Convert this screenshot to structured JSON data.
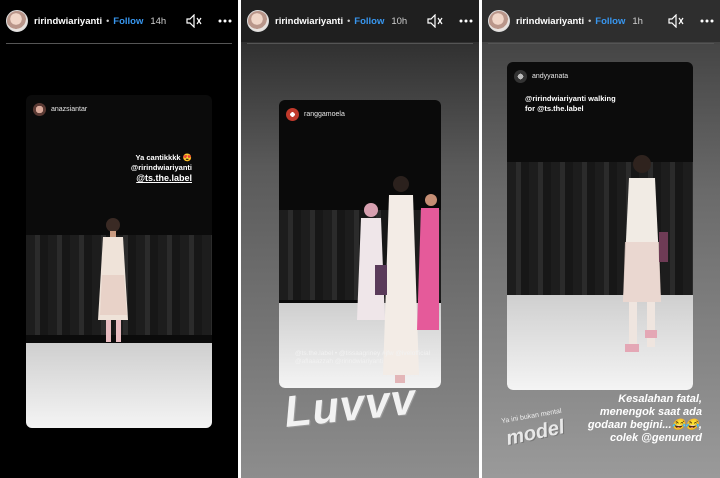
{
  "stories": [
    {
      "username": "ririndwiariyanti",
      "separator": "•",
      "follow_label": "Follow",
      "age": "14h",
      "card": {
        "poster": "anazsiantar",
        "caption_line1": "Ya cantikkkk 😍",
        "caption_line2": "@ririndwiariyanti",
        "caption_line3": "@ts.the.label"
      }
    },
    {
      "username": "ririndwiariyanti",
      "separator": "•",
      "follow_label": "Follow",
      "age": "10h",
      "card": {
        "poster": "ranggamoela",
        "caption_line1": "@ts.the.label • @tissaagriney #jfw @ivelofficial",
        "caption_line2": "@aflaaazzah @ririndwiariyanti"
      },
      "sticker_text": "Luvvv"
    },
    {
      "username": "ririndwiariyanti",
      "separator": "•",
      "follow_label": "Follow",
      "age": "1h",
      "card": {
        "poster": "andyyanata",
        "caption_line1": "@ririndwiariyanti walking",
        "caption_line2": "for @ts.the.label"
      },
      "small_text": "Ya ini bukan mental",
      "model_text": "model",
      "comment_line1": "Kesalahan fatal,",
      "comment_line2": "menengok saat ada",
      "comment_line3": "godaan begini...😂😂,",
      "comment_line4": "colek @genunerd"
    }
  ],
  "icons": {
    "volume": "speaker-icon",
    "more": "more-options-icon"
  },
  "colors": {
    "follow": "#3897f0",
    "background": "#000000"
  }
}
